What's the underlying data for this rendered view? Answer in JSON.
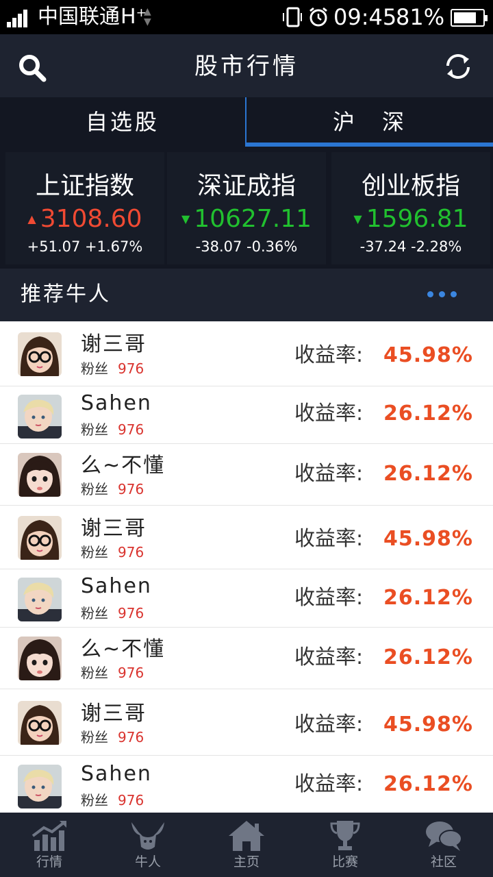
{
  "status_bar": {
    "carrier": "中国联通",
    "network": "H⁺",
    "time": "09:45",
    "battery_percent": "81%",
    "battery_level": 0.81
  },
  "header": {
    "title": "股市行情",
    "search_icon": "search-icon",
    "refresh_icon": "refresh-icon"
  },
  "tabs": [
    {
      "label": "自选股",
      "active": false
    },
    {
      "label": "沪　深",
      "active": true
    }
  ],
  "indices": [
    {
      "name": "上证指数",
      "value": "3108.60",
      "direction": "up",
      "arrow": "▲",
      "change": "+51.07 +1.67%"
    },
    {
      "name": "深证成指",
      "value": "10627.11",
      "direction": "down",
      "arrow": "▼",
      "change": "-38.07 -0.36%"
    },
    {
      "name": "创业板指",
      "value": "1596.81",
      "direction": "down",
      "arrow": "▼",
      "change": "-37.24 -2.28%"
    }
  ],
  "recommend": {
    "title": "推荐牛人",
    "more_icon": "more-dots-icon"
  },
  "experts": [
    {
      "name": "谢三哥",
      "fans_label": "粉丝",
      "fans": "976",
      "rate_label": "收益率:",
      "rate": "45.98%",
      "avatar": "girl-glasses"
    },
    {
      "name": "Sahen",
      "fans_label": "粉丝",
      "fans": "976",
      "rate_label": "收益率:",
      "rate": "26.12%",
      "avatar": "blond-baby"
    },
    {
      "name": "么~不懂",
      "fans_label": "粉丝",
      "fans": "976",
      "rate_label": "收益率:",
      "rate": "26.12%",
      "avatar": "girl-bangs"
    },
    {
      "name": "谢三哥",
      "fans_label": "粉丝",
      "fans": "976",
      "rate_label": "收益率:",
      "rate": "45.98%",
      "avatar": "girl-glasses"
    },
    {
      "name": "Sahen",
      "fans_label": "粉丝",
      "fans": "976",
      "rate_label": "收益率:",
      "rate": "26.12%",
      "avatar": "blond-baby"
    },
    {
      "name": "么~不懂",
      "fans_label": "粉丝",
      "fans": "976",
      "rate_label": "收益率:",
      "rate": "26.12%",
      "avatar": "girl-bangs"
    },
    {
      "name": "谢三哥",
      "fans_label": "粉丝",
      "fans": "976",
      "rate_label": "收益率:",
      "rate": "45.98%",
      "avatar": "girl-glasses"
    },
    {
      "name": "Sahen",
      "fans_label": "粉丝",
      "fans": "976",
      "rate_label": "收益率:",
      "rate": "26.12%",
      "avatar": "blond-baby"
    }
  ],
  "nav": [
    {
      "label": "行情",
      "icon": "chart-icon"
    },
    {
      "label": "牛人",
      "icon": "bull-icon"
    },
    {
      "label": "主页",
      "icon": "home-icon"
    },
    {
      "label": "比赛",
      "icon": "trophy-icon"
    },
    {
      "label": "社区",
      "icon": "chat-bubbles-icon"
    }
  ],
  "colors": {
    "up": "#f04a33",
    "down": "#21c02f",
    "accent": "#2b76d2",
    "rate": "#ea4e23",
    "bar_bg": "#1e2330"
  }
}
